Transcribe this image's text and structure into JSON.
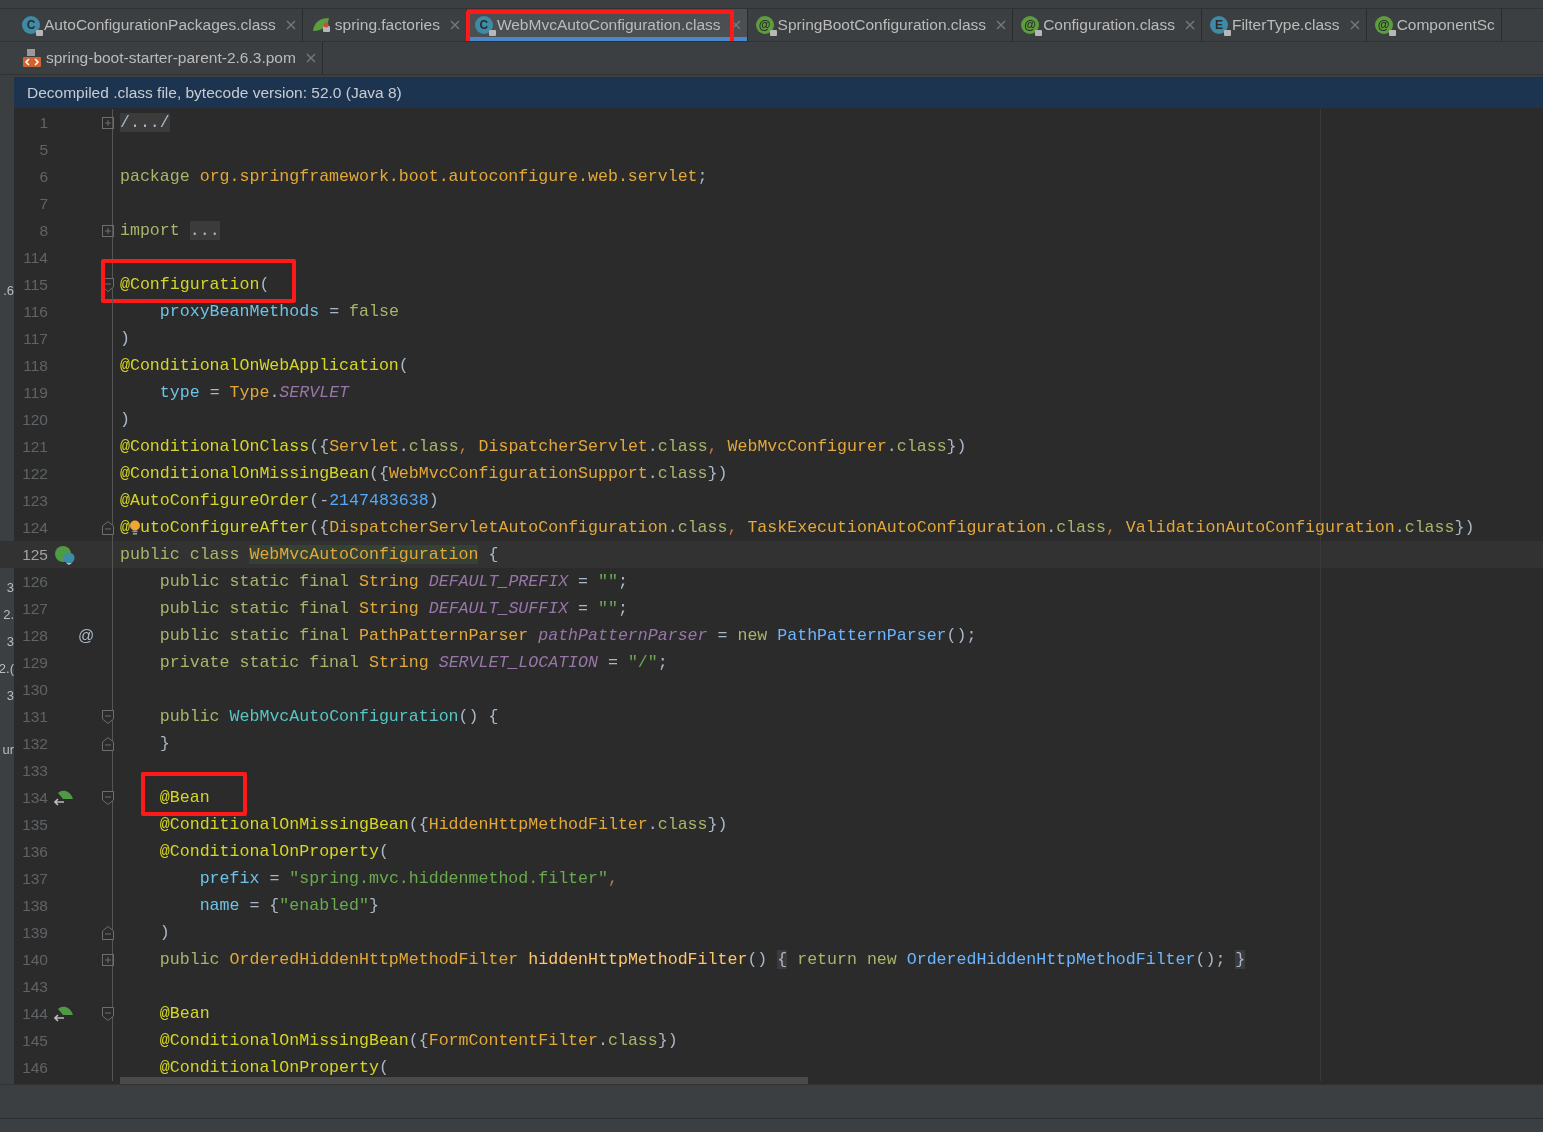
{
  "tab_rows": [
    {
      "tabs": [
        {
          "label": "AutoConfigurationPackages.class",
          "icon": {
            "kind": "class",
            "letter": "C"
          },
          "selected": false,
          "closable": true
        },
        {
          "label": "spring.factories",
          "icon": {
            "kind": "spring"
          },
          "selected": false,
          "closable": true
        },
        {
          "label": "WebMvcAutoConfiguration.class",
          "icon": {
            "kind": "class",
            "letter": "C"
          },
          "selected": true,
          "closable": true,
          "boxed": true
        },
        {
          "label": "SpringBootConfiguration.class",
          "icon": {
            "kind": "annotation",
            "letter": "@"
          },
          "selected": false,
          "closable": true
        },
        {
          "label": "Configuration.class",
          "icon": {
            "kind": "annotation",
            "letter": "@"
          },
          "selected": false,
          "closable": true
        },
        {
          "label": "FilterType.class",
          "icon": {
            "kind": "enum",
            "letter": "E"
          },
          "selected": false,
          "closable": true
        },
        {
          "label": "ComponentSc",
          "icon": {
            "kind": "annotation",
            "letter": "@"
          },
          "selected": false,
          "closable": false
        }
      ]
    },
    {
      "tabs": [
        {
          "label": "spring-boot-starter-parent-2.6.3.pom",
          "icon": {
            "kind": "maven"
          },
          "selected": false,
          "closable": true
        }
      ]
    }
  ],
  "notice": "Decompiled .class file, bytecode version: 52.0 (Java 8)",
  "editor": {
    "lines": [
      {
        "number": "1",
        "fold": {
          "kind": "expand"
        },
        "tokens": [
          {
            "kind": "fold",
            "text": "/.../"
          }
        ]
      },
      {
        "number": "5"
      },
      {
        "number": "6",
        "tokens": [
          {
            "kind": "kw",
            "text": "package "
          },
          {
            "kind": "cls",
            "text": "org.springframework.boot.autoconfigure.web.servlet"
          },
          {
            "kind": "plain",
            "text": ";"
          }
        ]
      },
      {
        "number": "7"
      },
      {
        "number": "8",
        "fold": {
          "kind": "expand"
        },
        "tokens": [
          {
            "kind": "kw",
            "text": "import "
          },
          {
            "kind": "fold",
            "text": "..."
          }
        ]
      },
      {
        "number": "114"
      },
      {
        "number": "115",
        "fold": {
          "kind": "start"
        },
        "boxed": true,
        "edge_text": ".6",
        "tokens": [
          {
            "kind": "ann",
            "text": "@Configuration"
          },
          {
            "kind": "plain",
            "text": "("
          }
        ]
      },
      {
        "number": "116",
        "tokens": [
          {
            "kind": "field",
            "text": "    proxyBeanMethods"
          },
          {
            "kind": "plain",
            "text": " = "
          },
          {
            "kind": "kw",
            "text": "false"
          }
        ]
      },
      {
        "number": "117",
        "tokens": [
          {
            "kind": "plain",
            "text": ")"
          }
        ]
      },
      {
        "number": "118",
        "tokens": [
          {
            "kind": "ann",
            "text": "@ConditionalOnWebApplication"
          },
          {
            "kind": "plain",
            "text": "("
          }
        ]
      },
      {
        "number": "119",
        "tokens": [
          {
            "kind": "field",
            "text": "    type"
          },
          {
            "kind": "plain",
            "text": " = "
          },
          {
            "kind": "cls",
            "text": "Type"
          },
          {
            "kind": "plain",
            "text": "."
          },
          {
            "kind": "const",
            "text": "SERVLET"
          }
        ]
      },
      {
        "number": "120",
        "tokens": [
          {
            "kind": "plain",
            "text": ")"
          }
        ]
      },
      {
        "number": "121",
        "tokens": [
          {
            "kind": "ann",
            "text": "@ConditionalOnClass"
          },
          {
            "kind": "plain",
            "text": "({"
          },
          {
            "kind": "cls",
            "text": "Servlet"
          },
          {
            "kind": "plain",
            "text": "."
          },
          {
            "kind": "kw",
            "text": "class"
          },
          {
            "kind": "comma",
            "text": ", "
          },
          {
            "kind": "cls",
            "text": "DispatcherServlet"
          },
          {
            "kind": "plain",
            "text": "."
          },
          {
            "kind": "kw",
            "text": "class"
          },
          {
            "kind": "comma",
            "text": ", "
          },
          {
            "kind": "cls",
            "text": "WebMvcConfigurer"
          },
          {
            "kind": "plain",
            "text": "."
          },
          {
            "kind": "kw",
            "text": "class"
          },
          {
            "kind": "plain",
            "text": "})"
          }
        ]
      },
      {
        "number": "122",
        "tokens": [
          {
            "kind": "ann",
            "text": "@ConditionalOnMissingBean"
          },
          {
            "kind": "plain",
            "text": "({"
          },
          {
            "kind": "cls",
            "text": "WebMvcConfigurationSupport"
          },
          {
            "kind": "plain",
            "text": "."
          },
          {
            "kind": "kw",
            "text": "class"
          },
          {
            "kind": "plain",
            "text": "})"
          }
        ]
      },
      {
        "number": "123",
        "tokens": [
          {
            "kind": "ann",
            "text": "@AutoConfigureOrder"
          },
          {
            "kind": "plain",
            "text": "(-"
          },
          {
            "kind": "num",
            "text": "2147483638"
          },
          {
            "kind": "plain",
            "text": ")"
          }
        ]
      },
      {
        "number": "124",
        "fold": {
          "kind": "end"
        },
        "tokens": [
          {
            "kind": "ann",
            "text": "@"
          },
          {
            "kind": "bulb"
          },
          {
            "kind": "ann",
            "text": "utoConfigureAfter"
          },
          {
            "kind": "plain",
            "text": "({"
          },
          {
            "kind": "cls",
            "text": "DispatcherServletAutoConfiguration"
          },
          {
            "kind": "plain",
            "text": "."
          },
          {
            "kind": "kw",
            "text": "class"
          },
          {
            "kind": "comma",
            "text": ", "
          },
          {
            "kind": "cls",
            "text": "TaskExecutionAutoConfiguration"
          },
          {
            "kind": "plain",
            "text": "."
          },
          {
            "kind": "kw",
            "text": "class"
          },
          {
            "kind": "comma",
            "text": ", "
          },
          {
            "kind": "cls",
            "text": "ValidationAutoConfiguration"
          },
          {
            "kind": "plain",
            "text": "."
          },
          {
            "kind": "kw",
            "text": "class"
          },
          {
            "kind": "plain",
            "text": "})"
          }
        ]
      },
      {
        "number": "125",
        "current": true,
        "gutter_icon": {
          "kind": "implemented"
        },
        "tokens": [
          {
            "kind": "kw",
            "text": "public class "
          },
          {
            "kind": "decl",
            "text": "WebMvcAutoConfiguration"
          },
          {
            "kind": "plain",
            "text": " {"
          }
        ]
      },
      {
        "number": "126",
        "edge_text": "3",
        "tokens": [
          {
            "kind": "kw",
            "text": "    public static final "
          },
          {
            "kind": "cls",
            "text": "String "
          },
          {
            "kind": "const",
            "text": "DEFAULT_PREFIX"
          },
          {
            "kind": "plain",
            "text": " = "
          },
          {
            "kind": "str",
            "text": "\"\""
          },
          {
            "kind": "plain",
            "text": ";"
          }
        ]
      },
      {
        "number": "127",
        "edge_text": "2.",
        "tokens": [
          {
            "kind": "kw",
            "text": "    public static final "
          },
          {
            "kind": "cls",
            "text": "String "
          },
          {
            "kind": "const",
            "text": "DEFAULT_SUFFIX"
          },
          {
            "kind": "plain",
            "text": " = "
          },
          {
            "kind": "str",
            "text": "\"\""
          },
          {
            "kind": "plain",
            "text": ";"
          }
        ]
      },
      {
        "number": "128",
        "edge_text": "3",
        "gutter_text": "@",
        "tokens": [
          {
            "kind": "kw",
            "text": "    public static final "
          },
          {
            "kind": "cls",
            "text": "PathPatternParser "
          },
          {
            "kind": "const",
            "text": "pathPatternParser"
          },
          {
            "kind": "plain",
            "text": " = "
          },
          {
            "kind": "kw",
            "text": "new "
          },
          {
            "kind": "newcls",
            "text": "PathPatternParser"
          },
          {
            "kind": "plain",
            "text": "();"
          }
        ]
      },
      {
        "number": "129",
        "edge_text": "2.(",
        "tokens": [
          {
            "kind": "kw",
            "text": "    private static final "
          },
          {
            "kind": "cls",
            "text": "String "
          },
          {
            "kind": "const",
            "text": "SERVLET_LOCATION"
          },
          {
            "kind": "plain",
            "text": " = "
          },
          {
            "kind": "str",
            "text": "\"/\""
          },
          {
            "kind": "plain",
            "text": ";"
          }
        ]
      },
      {
        "number": "130",
        "edge_text": "3"
      },
      {
        "number": "131",
        "fold": {
          "kind": "start"
        },
        "tokens": [
          {
            "kind": "kw",
            "text": "    public "
          },
          {
            "kind": "ctor",
            "text": "WebMvcAutoConfiguration"
          },
          {
            "kind": "plain",
            "text": "() {"
          }
        ]
      },
      {
        "number": "132",
        "fold": {
          "kind": "end"
        },
        "edge_text": "ur",
        "tokens": [
          {
            "kind": "plain",
            "text": "    }"
          }
        ]
      },
      {
        "number": "133"
      },
      {
        "number": "134",
        "fold": {
          "kind": "start"
        },
        "boxed": true,
        "gutter_icon": {
          "kind": "bean"
        },
        "tokens": [
          {
            "kind": "ann",
            "text": "    @Bean"
          }
        ]
      },
      {
        "number": "135",
        "tokens": [
          {
            "kind": "ann",
            "text": "    @ConditionalOnMissingBean"
          },
          {
            "kind": "plain",
            "text": "({"
          },
          {
            "kind": "cls",
            "text": "HiddenHttpMethodFilter"
          },
          {
            "kind": "plain",
            "text": "."
          },
          {
            "kind": "kw",
            "text": "class"
          },
          {
            "kind": "plain",
            "text": "})"
          }
        ]
      },
      {
        "number": "136",
        "tokens": [
          {
            "kind": "ann",
            "text": "    @ConditionalOnProperty"
          },
          {
            "kind": "plain",
            "text": "("
          }
        ]
      },
      {
        "number": "137",
        "tokens": [
          {
            "kind": "field",
            "text": "        prefix"
          },
          {
            "kind": "plain",
            "text": " = "
          },
          {
            "kind": "str",
            "text": "\"spring.mvc.hiddenmethod.filter\""
          },
          {
            "kind": "comma",
            "text": ","
          }
        ]
      },
      {
        "number": "138",
        "tokens": [
          {
            "kind": "field",
            "text": "        name"
          },
          {
            "kind": "plain",
            "text": " = {"
          },
          {
            "kind": "str",
            "text": "\"enabled\""
          },
          {
            "kind": "plain",
            "text": "}"
          }
        ]
      },
      {
        "number": "139",
        "fold": {
          "kind": "end"
        },
        "tokens": [
          {
            "kind": "plain",
            "text": "    )"
          }
        ]
      },
      {
        "number": "140",
        "fold": {
          "kind": "expand"
        },
        "tokens": [
          {
            "kind": "kw",
            "text": "    public "
          },
          {
            "kind": "cls",
            "text": "OrderedHiddenHttpMethodFilter "
          },
          {
            "kind": "method",
            "text": "hiddenHttpMethodFilter"
          },
          {
            "kind": "plain",
            "text": "() "
          },
          {
            "kind": "fold",
            "text": "{"
          },
          {
            "kind": "kw",
            "text": " return new "
          },
          {
            "kind": "newcls",
            "text": "OrderedHiddenHttpMethodFilter"
          },
          {
            "kind": "plain",
            "text": "(); "
          },
          {
            "kind": "fold",
            "text": "}"
          }
        ]
      },
      {
        "number": "143"
      },
      {
        "number": "144",
        "fold": {
          "kind": "start"
        },
        "gutter_icon": {
          "kind": "bean"
        },
        "tokens": [
          {
            "kind": "ann",
            "text": "    @Bean"
          }
        ]
      },
      {
        "number": "145",
        "tokens": [
          {
            "kind": "ann",
            "text": "    @ConditionalOnMissingBean"
          },
          {
            "kind": "plain",
            "text": "({"
          },
          {
            "kind": "cls",
            "text": "FormContentFilter"
          },
          {
            "kind": "plain",
            "text": "."
          },
          {
            "kind": "kw",
            "text": "class"
          },
          {
            "kind": "plain",
            "text": "})"
          }
        ]
      },
      {
        "number": "146",
        "tokens": [
          {
            "kind": "ann",
            "text": "    @ConditionalOnProperty"
          },
          {
            "kind": "plain",
            "text": "("
          }
        ]
      }
    ]
  }
}
